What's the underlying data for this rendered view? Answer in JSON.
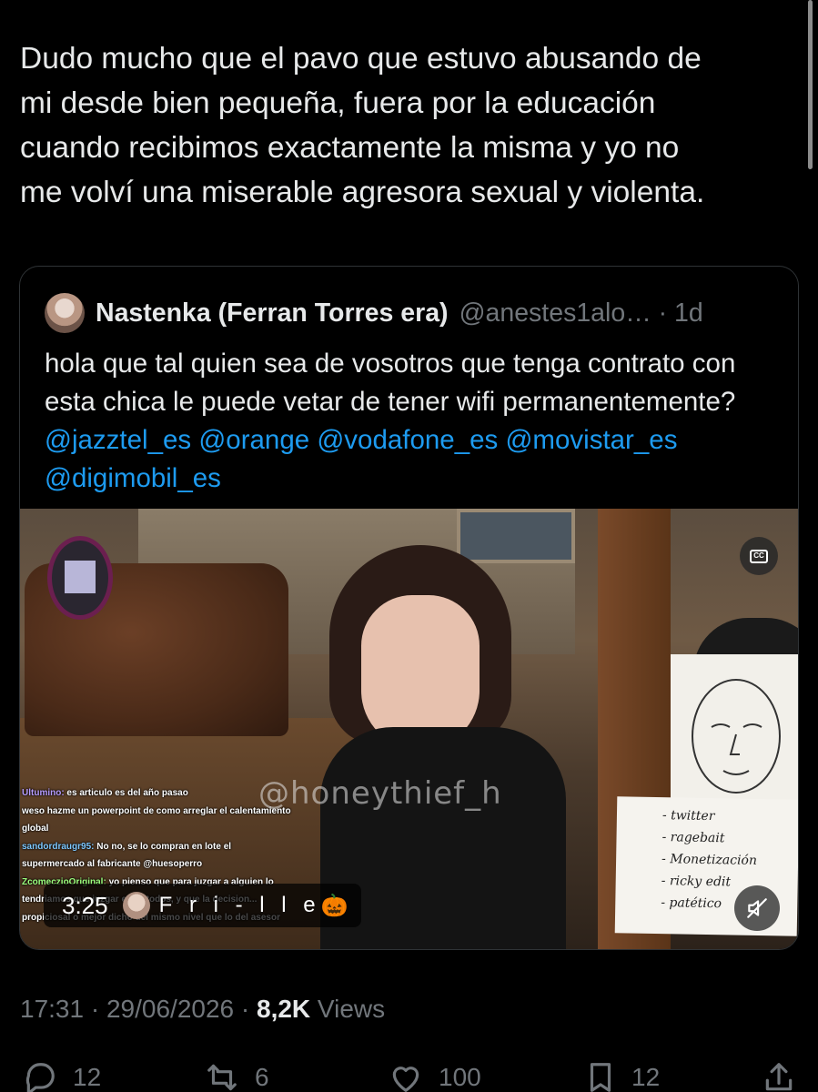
{
  "tweet": {
    "text": "Dudo mucho que el pavo que estuvo abusando de\nmi desde bien pequeña, fuera por la educación\ncuando recibimos exactamente la misma y yo no\nme volví una miserable agresora sexual y violenta."
  },
  "quote": {
    "name": "Nastenka (Ferran Torres era)",
    "handle": "@anestes1alo…",
    "separator": "·",
    "time": "1d",
    "text": "hola que tal quien sea de vosotros que tenga contrato con esta chica le puede vetar de tener wifi permanentemente? ",
    "mentions": [
      "@jazztel_es",
      "@orange",
      "@vodafone_es",
      "@movistar_es",
      "@digimobil_es"
    ]
  },
  "video": {
    "watermark": "@honeythief_h",
    "time": "3:25",
    "channel_name": "F r i - l l e",
    "channel_emoji": "🎃",
    "cc_label": "CC",
    "note_lines": [
      "- twitter",
      "- ragebait",
      "- Monetización",
      "- ricky edit",
      "- patético"
    ],
    "chat": [
      {
        "user": "Ultumino:",
        "msg": " es articulo es del año pasao"
      },
      {
        "user": "",
        "msg": "weso hazme un powerpoint de como arreglar el calentamiento global"
      },
      {
        "user": "sandordraugr95:",
        "msg": " No no, se lo compran en lote el supermercado al fabricante @huesoperro"
      },
      {
        "user": "ZcomeczioOriginal:",
        "msg": " yo pienso que para juzgar a alguien lo tendriamos que juzgar entre todos, y que la decision... propiciosal o mejor dicho del mismo nivel que lo del asesor"
      }
    ]
  },
  "meta": {
    "time": "17:31",
    "sep1": " · ",
    "date": "29/06/2026",
    "sep2": " · ",
    "views_count": "8,2K",
    "views_label": " Views"
  },
  "actions": {
    "replies": "12",
    "reposts": "6",
    "likes": "100",
    "bookmarks": "12"
  },
  "icons": [
    "reply-icon",
    "repost-icon",
    "like-icon",
    "bookmark-icon",
    "share-icon",
    "cc-icon",
    "mute-icon"
  ],
  "colors": {
    "background": "#000000",
    "text": "#e7e9ea",
    "secondary": "#71767b",
    "link": "#1d9bf0",
    "border": "#2f3336"
  }
}
